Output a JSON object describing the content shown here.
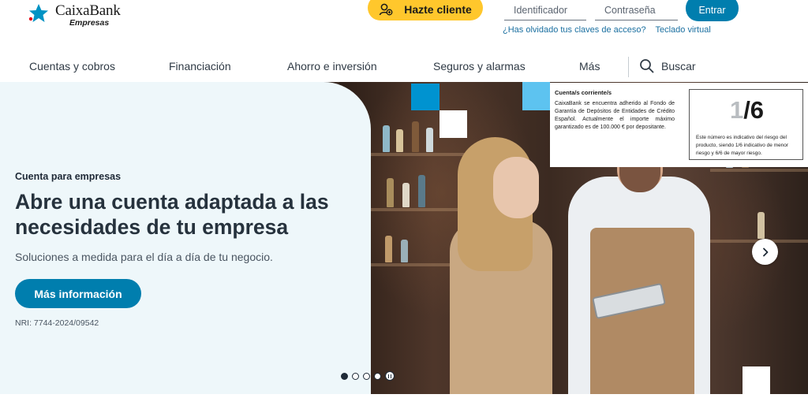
{
  "header": {
    "brand_name": "CaixaBank",
    "brand_sub": "Empresas",
    "cta_label": "Hazte cliente",
    "id_placeholder": "Identificador",
    "password_placeholder": "Contraseña",
    "login_label": "Entrar",
    "forgot_link": "¿Has olvidado tus claves de acceso?",
    "virtual_keyboard_link": "Teclado virtual"
  },
  "nav": {
    "items": [
      "Cuentas y cobros",
      "Financiación",
      "Ahorro e inversión",
      "Seguros y alarmas",
      "Más"
    ],
    "search_label": "Buscar"
  },
  "hero": {
    "eyebrow": "Cuenta para empresas",
    "headline": "Abre una cuenta adaptada a las necesidades de tu empresa",
    "subtext": "Soluciones a medida para el día a día de tu negocio.",
    "cta_label": "Más información",
    "nri": "NRI: 7744-2024/09542",
    "slide_count": 4,
    "active_slide": 1
  },
  "info_box": {
    "title": "Cuenta/s corriente/s",
    "body": "CaixaBank se encuentra adherido al Fondo de Garantía de Depósitos de Entidades de Crédito Español. Actualmente el importe máximo garantizado es de 100.000 € por depositante.",
    "risk_value": "1",
    "risk_total": "/6",
    "risk_text": "Este número es indicativo del riesgo del producto, siendo 1/6 indicativo de menor riesgo y 6/6 de mayor riesgo."
  },
  "colors": {
    "primary": "#007eae",
    "accent_yellow": "#ffc72c",
    "panel_bg": "#eef7fa"
  },
  "icons": [
    "caixabank-star-logo",
    "user-add-icon",
    "search-icon",
    "chevron-right-icon",
    "pause-icon"
  ]
}
